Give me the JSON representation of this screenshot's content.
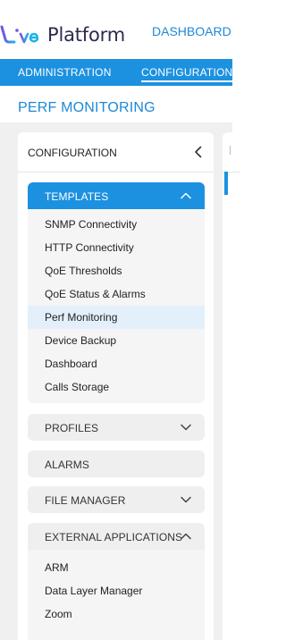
{
  "header": {
    "logo_text": "Platform",
    "dashboard_link": "DASHBOARD"
  },
  "nav": {
    "administration": "ADMINISTRATION",
    "configuration": "CONFIGURATION"
  },
  "page_title": "PERF MONITORING",
  "panel": {
    "title": "CONFIGURATION",
    "sections": [
      {
        "label": "TEMPLATES",
        "expanded": true,
        "active": true,
        "items": [
          "SNMP Connectivity",
          "HTTP Connectivity",
          "QoE Thresholds",
          "QoE Status & Alarms",
          "Perf Monitoring",
          "Device Backup",
          "Dashboard",
          "Calls Storage"
        ],
        "selected_item": "Perf Monitoring"
      },
      {
        "label": "PROFILES",
        "expanded": false
      },
      {
        "label": "ALARMS"
      },
      {
        "label": "FILE MANAGER",
        "expanded": false
      },
      {
        "label": "EXTERNAL APPLICATIONS",
        "expanded": true,
        "items": [
          "ARM",
          "Data Layer Manager",
          "Zoom"
        ]
      }
    ]
  },
  "colors": {
    "primary_blue": "#1c91e0",
    "title_blue": "#1e88d6",
    "logo_dark": "#2b2b4e",
    "selected_row": "#e3f0fb",
    "section_bg": "#efefef",
    "frame_bg": "#f0f0f0"
  },
  "icons": {
    "collapse_panel": "chevron-left-icon",
    "expanded_section": "chevron-up-icon",
    "collapsed_section": "chevron-down-icon"
  }
}
